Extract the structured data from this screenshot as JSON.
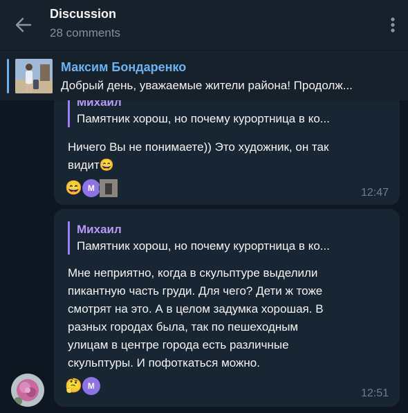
{
  "header": {
    "title": "Discussion",
    "subtitle": "28 comments",
    "back_icon": "arrow-left-icon",
    "more_icon": "kebab-menu-icon"
  },
  "pinned": {
    "name": "Максим Бондаренко",
    "text": "Добрый день, уважаемые жители района! Продолж..."
  },
  "messages": [
    {
      "reply_name": "Михаил",
      "reply_text": "Памятник хорош, но почему курортница в ко...",
      "text_line1": "Ничего Вы не понимаете)) Это художник, он так",
      "text_line2": "видит",
      "emoji_inline": "😄",
      "reaction_emoji": "😄",
      "reaction_avatar_letter": "М",
      "time": "12:47"
    },
    {
      "reply_name": "Михаил",
      "reply_text": "Памятник хорош, но почему курортница в ко...",
      "lines": [
        "Мне неприятно, когда в скульптуре выделили",
        "пикантную часть груди. Для чего? Дети ж тоже",
        "смотрят на это. А в целом задумка хорошая. В",
        "разных городах была, так по пешеходным",
        "улицам в центре города есть различные",
        "скульптуры. И пофоткаться можно."
      ],
      "reaction_emoji": "🤔",
      "reaction_avatar_letter": "М",
      "time": "12:51"
    }
  ],
  "colors": {
    "background": "#0e1621",
    "header": "#17212b",
    "bubble": "#182533",
    "accent": "#6ab3f3",
    "reply_accent": "#a17ff2"
  }
}
